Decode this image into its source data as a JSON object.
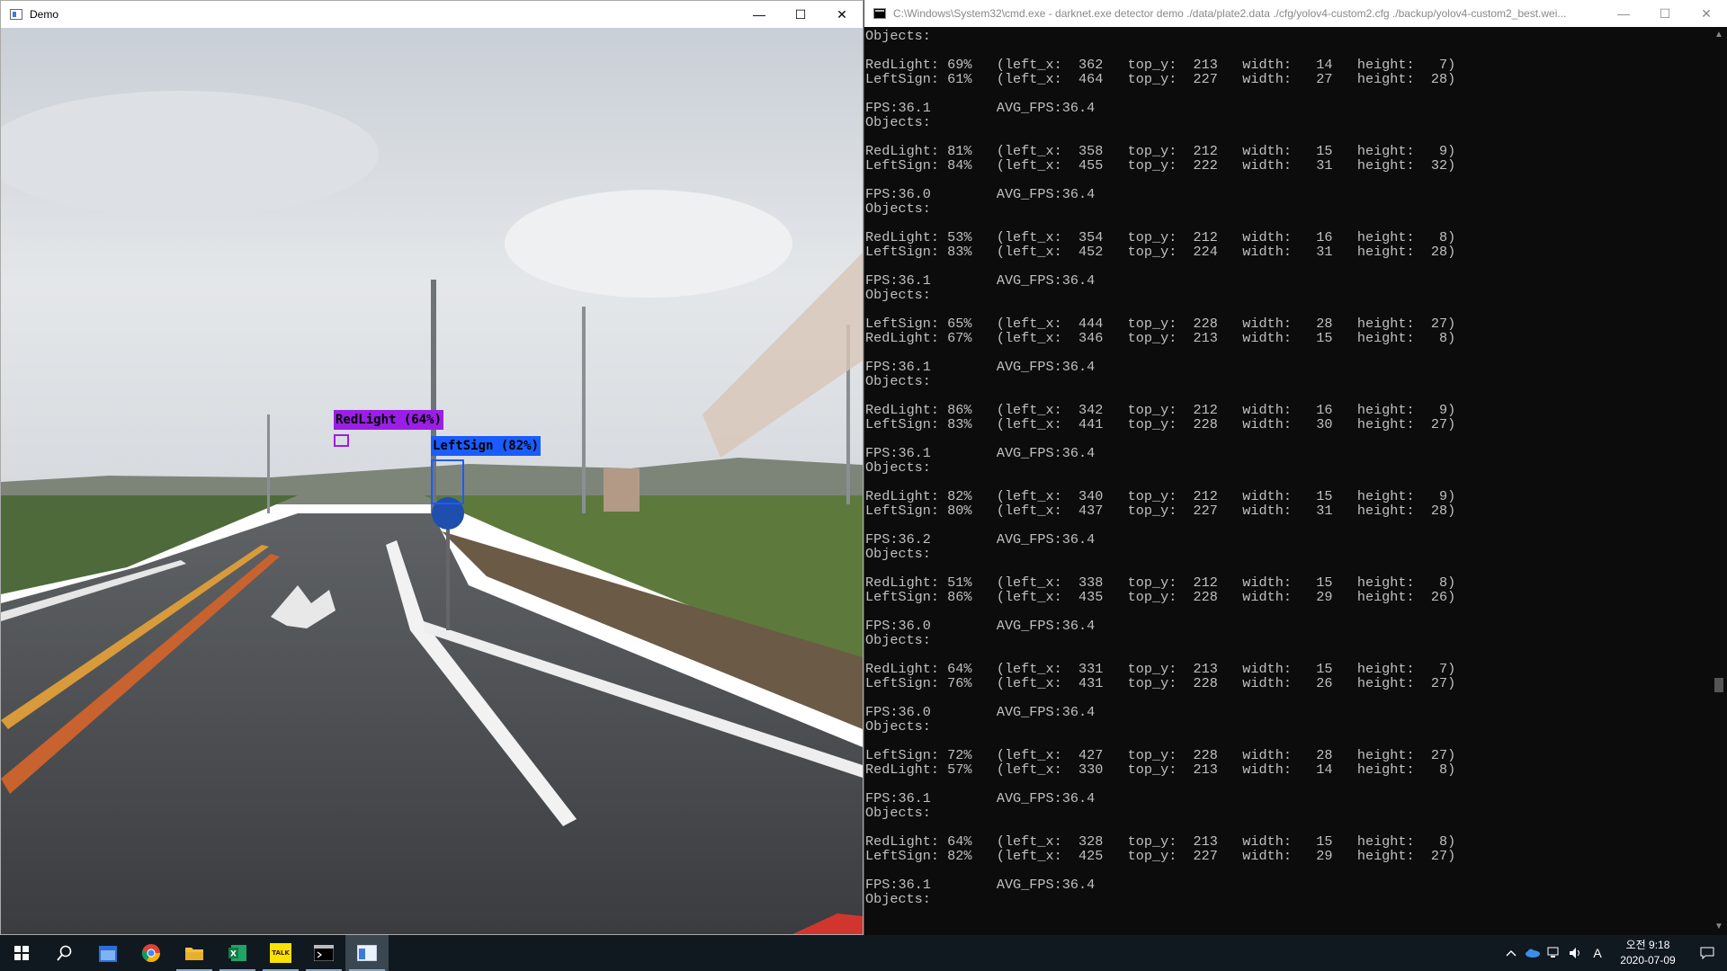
{
  "demo_window": {
    "title": "Demo",
    "minimize": "—",
    "maximize": "☐",
    "close": "✕",
    "detections": [
      {
        "label": "RedLight (64%)",
        "color": "#9b1ee6"
      },
      {
        "label": "LeftSign (82%)",
        "color": "#1a5cff"
      }
    ]
  },
  "cmd_window": {
    "title": "C:\\Windows\\System32\\cmd.exe - darknet.exe  detector demo ./data/plate2.data ./cfg/yolov4-custom2.cfg ./backup/yolov4-custom2_best.wei...",
    "minimize": "—",
    "maximize": "☐",
    "close": "✕",
    "console_lines": [
      "Objects:",
      "",
      "RedLight: 69%   (left_x:  362   top_y:  213   width:   14   height:   7)",
      "LeftSign: 61%   (left_x:  464   top_y:  227   width:   27   height:  28)",
      "",
      "FPS:36.1        AVG_FPS:36.4",
      "Objects:",
      "",
      "RedLight: 81%   (left_x:  358   top_y:  212   width:   15   height:   9)",
      "LeftSign: 84%   (left_x:  455   top_y:  222   width:   31   height:  32)",
      "",
      "FPS:36.0        AVG_FPS:36.4",
      "Objects:",
      "",
      "RedLight: 53%   (left_x:  354   top_y:  212   width:   16   height:   8)",
      "LeftSign: 83%   (left_x:  452   top_y:  224   width:   31   height:  28)",
      "",
      "FPS:36.1        AVG_FPS:36.4",
      "Objects:",
      "",
      "LeftSign: 65%   (left_x:  444   top_y:  228   width:   28   height:  27)",
      "RedLight: 67%   (left_x:  346   top_y:  213   width:   15   height:   8)",
      "",
      "FPS:36.1        AVG_FPS:36.4",
      "Objects:",
      "",
      "RedLight: 86%   (left_x:  342   top_y:  212   width:   16   height:   9)",
      "LeftSign: 83%   (left_x:  441   top_y:  228   width:   30   height:  27)",
      "",
      "FPS:36.1        AVG_FPS:36.4",
      "Objects:",
      "",
      "RedLight: 82%   (left_x:  340   top_y:  212   width:   15   height:   9)",
      "LeftSign: 80%   (left_x:  437   top_y:  227   width:   31   height:  28)",
      "",
      "FPS:36.2        AVG_FPS:36.4",
      "Objects:",
      "",
      "RedLight: 51%   (left_x:  338   top_y:  212   width:   15   height:   8)",
      "LeftSign: 86%   (left_x:  435   top_y:  228   width:   29   height:  26)",
      "",
      "FPS:36.0        AVG_FPS:36.4",
      "Objects:",
      "",
      "RedLight: 64%   (left_x:  331   top_y:  213   width:   15   height:   7)",
      "LeftSign: 76%   (left_x:  431   top_y:  228   width:   26   height:  27)",
      "",
      "FPS:36.0        AVG_FPS:36.4",
      "Objects:",
      "",
      "LeftSign: 72%   (left_x:  427   top_y:  228   width:   28   height:  27)",
      "RedLight: 57%   (left_x:  330   top_y:  213   width:   14   height:   8)",
      "",
      "FPS:36.1        AVG_FPS:36.4",
      "Objects:",
      "",
      "RedLight: 64%   (left_x:  328   top_y:  213   width:   15   height:   8)",
      "LeftSign: 82%   (left_x:  425   top_y:  227   width:   29   height:  27)",
      "",
      "FPS:36.1        AVG_FPS:36.4",
      "Objects:"
    ]
  },
  "taskbar": {
    "apps": [
      {
        "name": "start",
        "icon": "windows-icon"
      },
      {
        "name": "search",
        "icon": "search-icon"
      },
      {
        "name": "calendar",
        "icon": "calendar-icon"
      },
      {
        "name": "chrome",
        "icon": "chrome-icon"
      },
      {
        "name": "file-explorer",
        "icon": "folder-icon"
      },
      {
        "name": "excel",
        "icon": "excel-icon"
      },
      {
        "name": "kakaotalk",
        "icon": "talk-icon",
        "text": "TALK"
      },
      {
        "name": "cmd",
        "icon": "terminal-icon"
      },
      {
        "name": "demo",
        "icon": "window-icon"
      }
    ],
    "tray": {
      "ime": "A",
      "time": "오전 9:18",
      "date": "2020-07-09"
    }
  }
}
